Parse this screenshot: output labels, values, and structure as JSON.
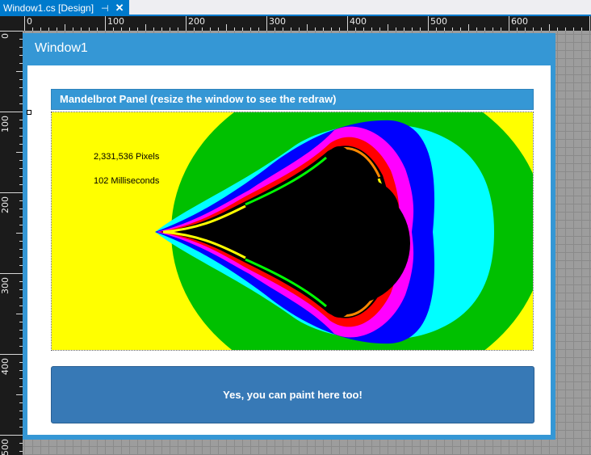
{
  "tab": {
    "title": "Window1.cs [Design]",
    "pin_glyph": "⊣",
    "close_glyph": "✕"
  },
  "ruler": {
    "horizontal_labels": [
      "0",
      "100",
      "200",
      "300",
      "400",
      "500",
      "600"
    ],
    "vertical_labels": [
      "0",
      "100",
      "200",
      "300",
      "400",
      "500"
    ]
  },
  "window": {
    "title": "Window1"
  },
  "panel": {
    "header": "Mandelbrot Panel (resize the window to see the redraw)",
    "pixels": "2,331,536 Pixels",
    "milliseconds": "102 Milliseconds"
  },
  "paint_button": {
    "label": "Yes, you can paint here too!"
  },
  "colors": {
    "accent": "#3597d5",
    "button": "#3779b6",
    "fractal_palette": [
      "#ffff00",
      "#00c000",
      "#00ffff",
      "#0000ff",
      "#ff00ff",
      "#ff0000",
      "#000000"
    ]
  }
}
